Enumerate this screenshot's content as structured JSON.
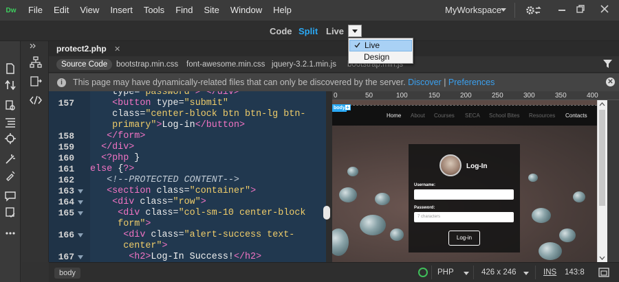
{
  "menubar": {
    "logo": "Dw",
    "items": [
      "File",
      "Edit",
      "View",
      "Insert",
      "Tools",
      "Find",
      "Site",
      "Window",
      "Help"
    ],
    "workspace": "MyWorkspace"
  },
  "viewbar": {
    "modes": [
      "Code",
      "Split",
      "Live"
    ],
    "active": "Split"
  },
  "view_dropdown": {
    "items": [
      "Live",
      "Design"
    ],
    "selected": "Live"
  },
  "document": {
    "tab_title": "protect2.php",
    "related_files": [
      "Source Code",
      "bootstrap.min.css",
      "font-awesome.min.css",
      "jquery-3.2.1.min.js",
      "bootstrap.min.js"
    ]
  },
  "infobar": {
    "message": "This page may have dynamically-related files that can only be discovered by the server.",
    "link_discover": "Discover",
    "separator": "|",
    "link_preferences": "Preferences"
  },
  "code": {
    "line_numbers": [
      "157",
      "158",
      "159",
      "160",
      "161",
      "162",
      "163",
      "164",
      "165",
      "166",
      "167"
    ],
    "lines": [
      "    type=\"password\"> </div>",
      "    <button type=\"submit\"",
      "    class=\"center-block btn btn-lg btn-",
      "    primary\">Log-in</button>",
      "   </form>",
      "  </div>",
      "  <?php }",
      "else {?>",
      "   <!--PROTECTED CONTENT-->",
      "   <section class=\"container\">",
      "    <div class=\"row\">",
      "     <div class=\"col-sm-10 center-block",
      "     form\">",
      "      <div class=\"alert-success text-",
      "      center\">",
      "       <h2>Log-In Success!</h2>"
    ]
  },
  "ruler": {
    "labels": [
      "0",
      "50",
      "100",
      "150",
      "200",
      "250",
      "300",
      "350",
      "400"
    ]
  },
  "live": {
    "body_tag": "body",
    "body_plus": "+",
    "nav_links": [
      "Home",
      "About",
      "Courses",
      "SECA",
      "School Bites",
      "Resources",
      "Contacts"
    ],
    "login_title": "Log-In",
    "username_label": "Username:",
    "password_label": "Password:",
    "password_placeholder": "7 characters",
    "login_button": "Log-in"
  },
  "statusbar": {
    "breadcrumb": "body",
    "language": "PHP",
    "size": "426 x 246",
    "mode": "INS",
    "position": "143:8"
  },
  "colors": {
    "accent": "#2aa9f5",
    "code_bg": "#21384f",
    "tag": "#f274c4",
    "string": "#f0cd6a",
    "ok": "#3fbf5a"
  }
}
